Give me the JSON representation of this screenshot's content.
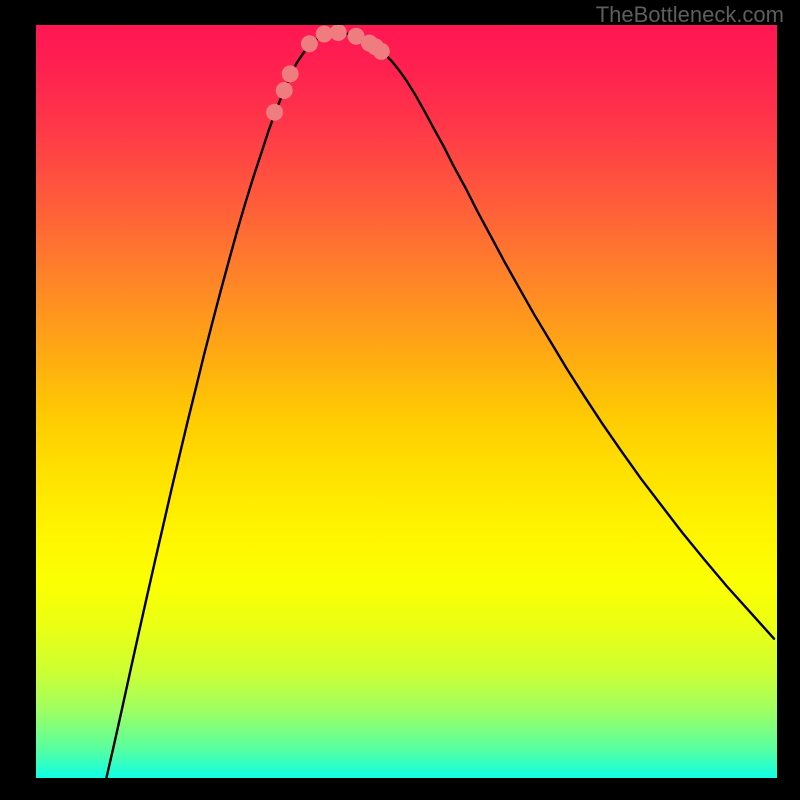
{
  "watermark": "TheBottleneck.com",
  "chart_data": {
    "type": "line",
    "title": "",
    "xlabel": "",
    "ylabel": "",
    "xlim": [
      0,
      100
    ],
    "ylim": [
      0,
      100
    ],
    "grid": false,
    "legend": false,
    "background": "rainbow-gradient (red top to cyan/green bottom)",
    "curve_norm_xy": [
      [
        0.095,
        0.0
      ],
      [
        0.106,
        0.047
      ],
      [
        0.117,
        0.096
      ],
      [
        0.128,
        0.145
      ],
      [
        0.139,
        0.194
      ],
      [
        0.15,
        0.242
      ],
      [
        0.161,
        0.29
      ],
      [
        0.172,
        0.337
      ],
      [
        0.183,
        0.384
      ],
      [
        0.194,
        0.43
      ],
      [
        0.205,
        0.475
      ],
      [
        0.216,
        0.519
      ],
      [
        0.227,
        0.563
      ],
      [
        0.238,
        0.605
      ],
      [
        0.249,
        0.646
      ],
      [
        0.26,
        0.686
      ],
      [
        0.271,
        0.725
      ],
      [
        0.282,
        0.762
      ],
      [
        0.293,
        0.797
      ],
      [
        0.304,
        0.83
      ],
      [
        0.314,
        0.86
      ],
      [
        0.324,
        0.887
      ],
      [
        0.334,
        0.911
      ],
      [
        0.343,
        0.932
      ],
      [
        0.352,
        0.95
      ],
      [
        0.361,
        0.963
      ],
      [
        0.37,
        0.974
      ],
      [
        0.379,
        0.981
      ],
      [
        0.388,
        0.986
      ],
      [
        0.397,
        0.989
      ],
      [
        0.406,
        0.99
      ],
      [
        0.415,
        0.989
      ],
      [
        0.424,
        0.988
      ],
      [
        0.433,
        0.985
      ],
      [
        0.442,
        0.982
      ],
      [
        0.451,
        0.977
      ],
      [
        0.46,
        0.97
      ],
      [
        0.47,
        0.962
      ],
      [
        0.48,
        0.952
      ],
      [
        0.49,
        0.94
      ],
      [
        0.5,
        0.926
      ],
      [
        0.512,
        0.907
      ],
      [
        0.524,
        0.886
      ],
      [
        0.536,
        0.864
      ],
      [
        0.55,
        0.839
      ],
      [
        0.564,
        0.812
      ],
      [
        0.58,
        0.783
      ],
      [
        0.596,
        0.752
      ],
      [
        0.614,
        0.719
      ],
      [
        0.632,
        0.686
      ],
      [
        0.652,
        0.651
      ],
      [
        0.672,
        0.616
      ],
      [
        0.694,
        0.58
      ],
      [
        0.716,
        0.544
      ],
      [
        0.74,
        0.507
      ],
      [
        0.764,
        0.471
      ],
      [
        0.79,
        0.434
      ],
      [
        0.816,
        0.398
      ],
      [
        0.844,
        0.362
      ],
      [
        0.872,
        0.326
      ],
      [
        0.902,
        0.29
      ],
      [
        0.932,
        0.255
      ],
      [
        0.964,
        0.22
      ],
      [
        0.996,
        0.185
      ]
    ],
    "series": [
      {
        "name": "bottleneck-curve",
        "type": "line",
        "color": "#000000"
      },
      {
        "name": "highlight-markers",
        "type": "scatter",
        "color": "#ef7c7e",
        "points_norm_xy": [
          [
            0.322,
            0.884
          ],
          [
            0.335,
            0.913
          ],
          [
            0.343,
            0.935
          ],
          [
            0.369,
            0.975
          ],
          [
            0.389,
            0.988
          ],
          [
            0.408,
            0.99
          ],
          [
            0.432,
            0.985
          ],
          [
            0.45,
            0.976
          ],
          [
            0.458,
            0.971
          ],
          [
            0.466,
            0.965
          ]
        ]
      }
    ]
  }
}
